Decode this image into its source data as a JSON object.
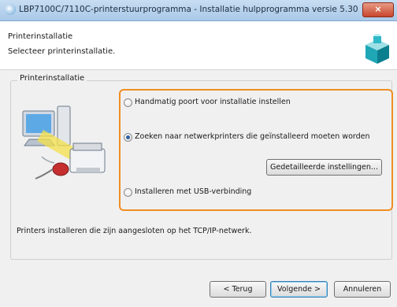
{
  "window": {
    "title": "LBP7100C/7110C-printerstuurprogramma - Installatie hulpprogramma versie 5.30",
    "close_symbol": "×"
  },
  "header": {
    "title": "Printerinstallatie",
    "subtitle": "Selecteer printerinstallatie.",
    "icon": "installer-box-icon"
  },
  "group": {
    "label": "Printerinstallatie",
    "options": [
      {
        "label": "Handmatig poort voor installatie instellen",
        "checked": false
      },
      {
        "label": "Zoeken naar netwerkprinters die geïnstalleerd moeten worden",
        "checked": true
      },
      {
        "label": "Installeren met USB-verbinding",
        "checked": false
      }
    ],
    "details_button": "Gedetailleerde instellingen...",
    "info_text": "Printers installeren die zijn aangesloten op het TCP/IP-netwerk.",
    "highlight_color": "#ef8e22"
  },
  "footer": {
    "back": "< Terug",
    "next": "Volgende >",
    "cancel": "Annuleren"
  }
}
